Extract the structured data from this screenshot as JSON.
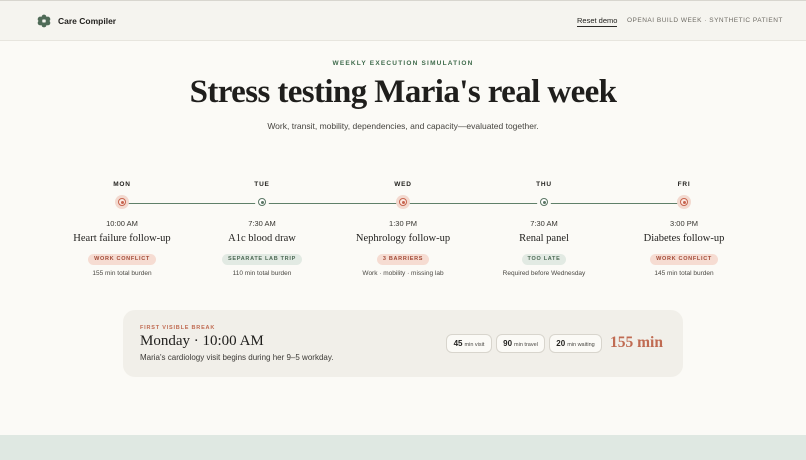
{
  "app": {
    "name": "Care Compiler",
    "logo_icon": "flower-icon",
    "accent": "#3f6b4c"
  },
  "nav": {
    "reset_label": "Reset demo",
    "event_label": "OPENAI BUILD WEEK · SYNTHETIC PATIENT"
  },
  "hero": {
    "eyebrow": "WEEKLY EXECUTION SIMULATION",
    "title": "Stress testing Maria's real week",
    "subtitle": "Work, transit, mobility, dependencies, and capacity—evaluated together."
  },
  "days": [
    {
      "day": "MON",
      "time": "10:00 AM",
      "visit": "Heart failure follow-up",
      "tag": "WORK CONFLICT",
      "tag_kind": "bad",
      "note": "155 min total burden",
      "status": "alert"
    },
    {
      "day": "TUE",
      "time": "7:30 AM",
      "visit": "A1c blood draw",
      "tag": "SEPARATE LAB TRIP",
      "tag_kind": "neutral",
      "note": "110 min total burden",
      "status": "ok"
    },
    {
      "day": "WED",
      "time": "1:30 PM",
      "visit": "Nephrology follow-up",
      "tag": "3 BARRIERS",
      "tag_kind": "bad",
      "note": "Work · mobility · missing lab",
      "status": "alert"
    },
    {
      "day": "THU",
      "time": "7:30 AM",
      "visit": "Renal panel",
      "tag": "TOO LATE",
      "tag_kind": "neutral",
      "note": "Required before Wednesday",
      "status": "ok"
    },
    {
      "day": "FRI",
      "time": "3:00 PM",
      "visit": "Diabetes follow-up",
      "tag": "WORK CONFLICT",
      "tag_kind": "bad",
      "note": "145 min total burden",
      "status": "alert"
    }
  ],
  "break_card": {
    "eyebrow": "FIRST VISIBLE BREAK",
    "title": "Monday · 10:00 AM",
    "description": "Maria's cardiology visit begins during her 9–5 workday.",
    "pills": [
      {
        "value": "45",
        "unit": "min visit"
      },
      {
        "value": "90",
        "unit": "min travel"
      },
      {
        "value": "20",
        "unit": "min waiting"
      }
    ],
    "total": "155 min",
    "total_color": "#c06b52"
  }
}
